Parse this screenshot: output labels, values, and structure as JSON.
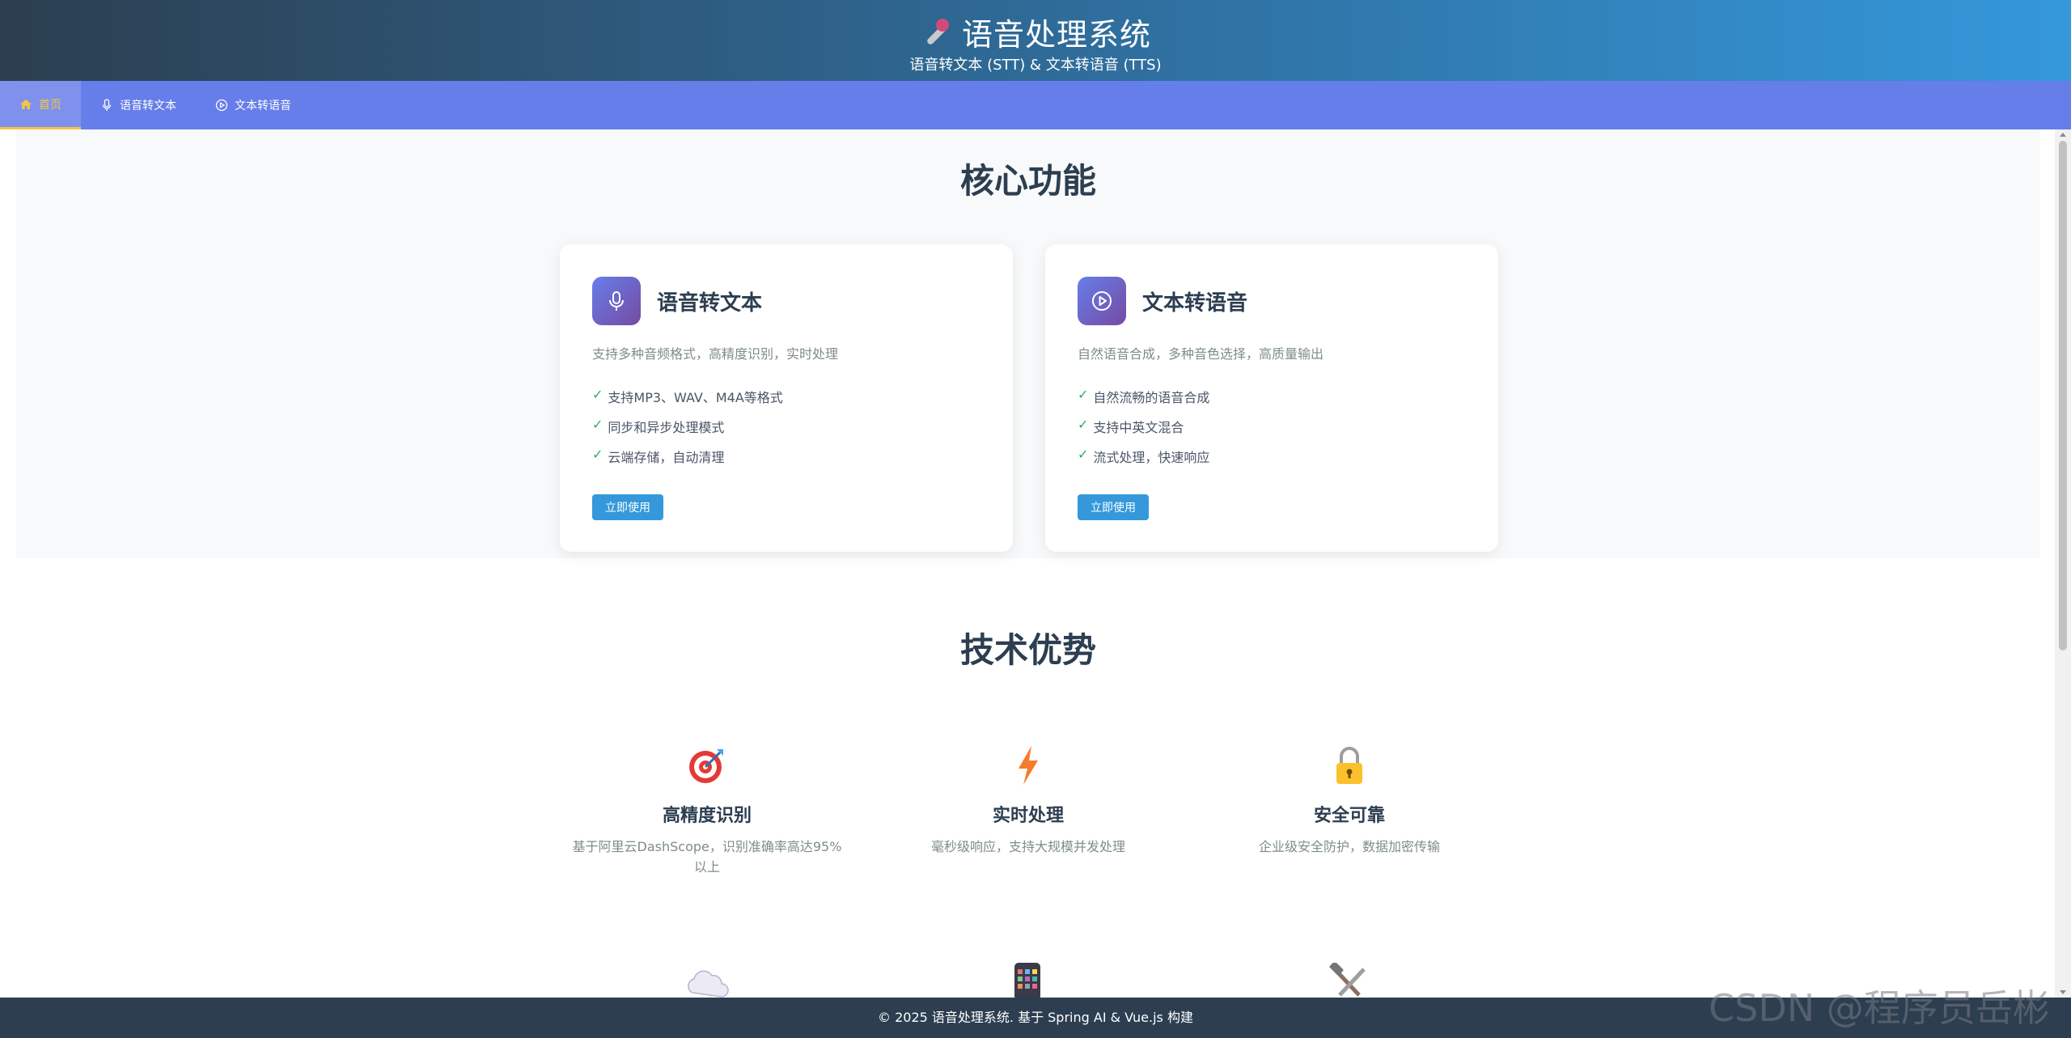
{
  "header": {
    "title": "语音处理系统",
    "subtitle": "语音转文本 (STT) & 文本转语音 (TTS)",
    "icon": "microphone-emoji-icon"
  },
  "nav": {
    "tabs": [
      {
        "label": "首页",
        "icon": "home-icon",
        "active": true
      },
      {
        "label": "语音转文本",
        "icon": "microphone-icon",
        "active": false
      },
      {
        "label": "文本转语音",
        "icon": "play-circle-icon",
        "active": false
      }
    ]
  },
  "features": {
    "title": "核心功能",
    "cards": [
      {
        "title": "语音转文本",
        "icon": "microphone-icon",
        "description": "支持多种音频格式，高精度识别，实时处理",
        "items": [
          "支持MP3、WAV、M4A等格式",
          "同步和异步处理模式",
          "云端存储，自动清理"
        ],
        "button": "立即使用"
      },
      {
        "title": "文本转语音",
        "icon": "play-circle-icon",
        "description": "自然语音合成，多种音色选择，高质量输出",
        "items": [
          "自然流畅的语音合成",
          "支持中英文混合",
          "流式处理，快速响应"
        ],
        "button": "立即使用"
      }
    ]
  },
  "advantages": {
    "title": "技术优势",
    "items": [
      {
        "title": "高精度识别",
        "description": "基于阿里云DashScope，识别准确率高达95%以上",
        "icon": "target-icon"
      },
      {
        "title": "实时处理",
        "description": "毫秒级响应，支持大规模并发处理",
        "icon": "lightning-icon"
      },
      {
        "title": "安全可靠",
        "description": "企业级安全防护，数据加密传输",
        "icon": "lock-icon"
      }
    ],
    "partial_icons": [
      "cloud-icon",
      "mobile-phone-icon",
      "tools-icon"
    ]
  },
  "footer": {
    "text": "© 2025 语音处理系统. 基于 Spring AI & Vue.js 构建"
  },
  "watermark": "CSDN @程序员岳彬",
  "colors": {
    "header_start": "#2c3e50",
    "header_end": "#3498db",
    "nav": "#667eea",
    "active_tab": "#f5c542",
    "button": "#3498db",
    "check": "#27ae60",
    "footer": "#2c3e50"
  }
}
